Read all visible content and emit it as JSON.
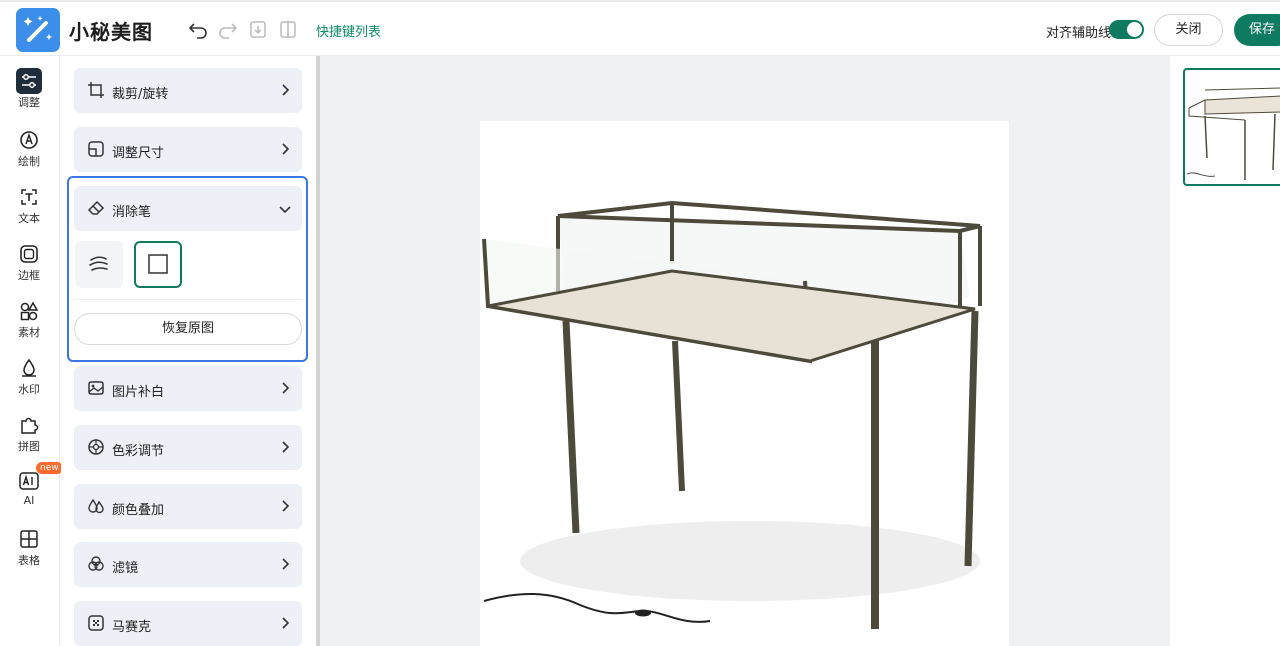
{
  "app": {
    "title": "小秘美图"
  },
  "toolbar": {
    "icons": [
      "undo-icon",
      "redo-icon",
      "export-icon",
      "compare-icon"
    ],
    "shortcut_link": "快捷键列表",
    "align_label": "对齐辅助线",
    "align_enabled": true,
    "close_label": "关闭",
    "save_label": "保存"
  },
  "rail": {
    "items": [
      {
        "label": "调整",
        "icon": "sliders-icon",
        "active": true
      },
      {
        "label": "绘制",
        "icon": "pen-icon"
      },
      {
        "label": "文本",
        "icon": "text-icon"
      },
      {
        "label": "边框",
        "icon": "border-icon"
      },
      {
        "label": "素材",
        "icon": "shapes-icon"
      },
      {
        "label": "水印",
        "icon": "watermark-icon"
      },
      {
        "label": "拼图",
        "icon": "puzzle-icon"
      },
      {
        "label": "AI",
        "icon": "ai-icon",
        "badge": "new"
      },
      {
        "label": "表格",
        "icon": "table-icon"
      }
    ]
  },
  "panel": {
    "tools": [
      {
        "label": "裁剪/旋转",
        "icon": "crop-icon"
      },
      {
        "label": "调整尺寸",
        "icon": "resize-icon"
      },
      {
        "label": "消除笔",
        "icon": "eraser-icon",
        "expanded": true
      },
      {
        "label": "图片补白",
        "icon": "image-fill-icon"
      },
      {
        "label": "色彩调节",
        "icon": "color-wheel-icon"
      },
      {
        "label": "颜色叠加",
        "icon": "color-overlay-icon"
      },
      {
        "label": "滤镜",
        "icon": "filter-icon"
      },
      {
        "label": "马赛克",
        "icon": "mosaic-icon"
      }
    ],
    "eraser": {
      "modes": [
        "brush-stroke-icon",
        "rectangle-select-icon"
      ],
      "selected_mode": "rectangle-select-icon",
      "restore_label": "恢复原图"
    }
  },
  "colors": {
    "accent": "#0e7a5f",
    "highlight": "#3a76e8",
    "logo": "#3b8ee9"
  }
}
